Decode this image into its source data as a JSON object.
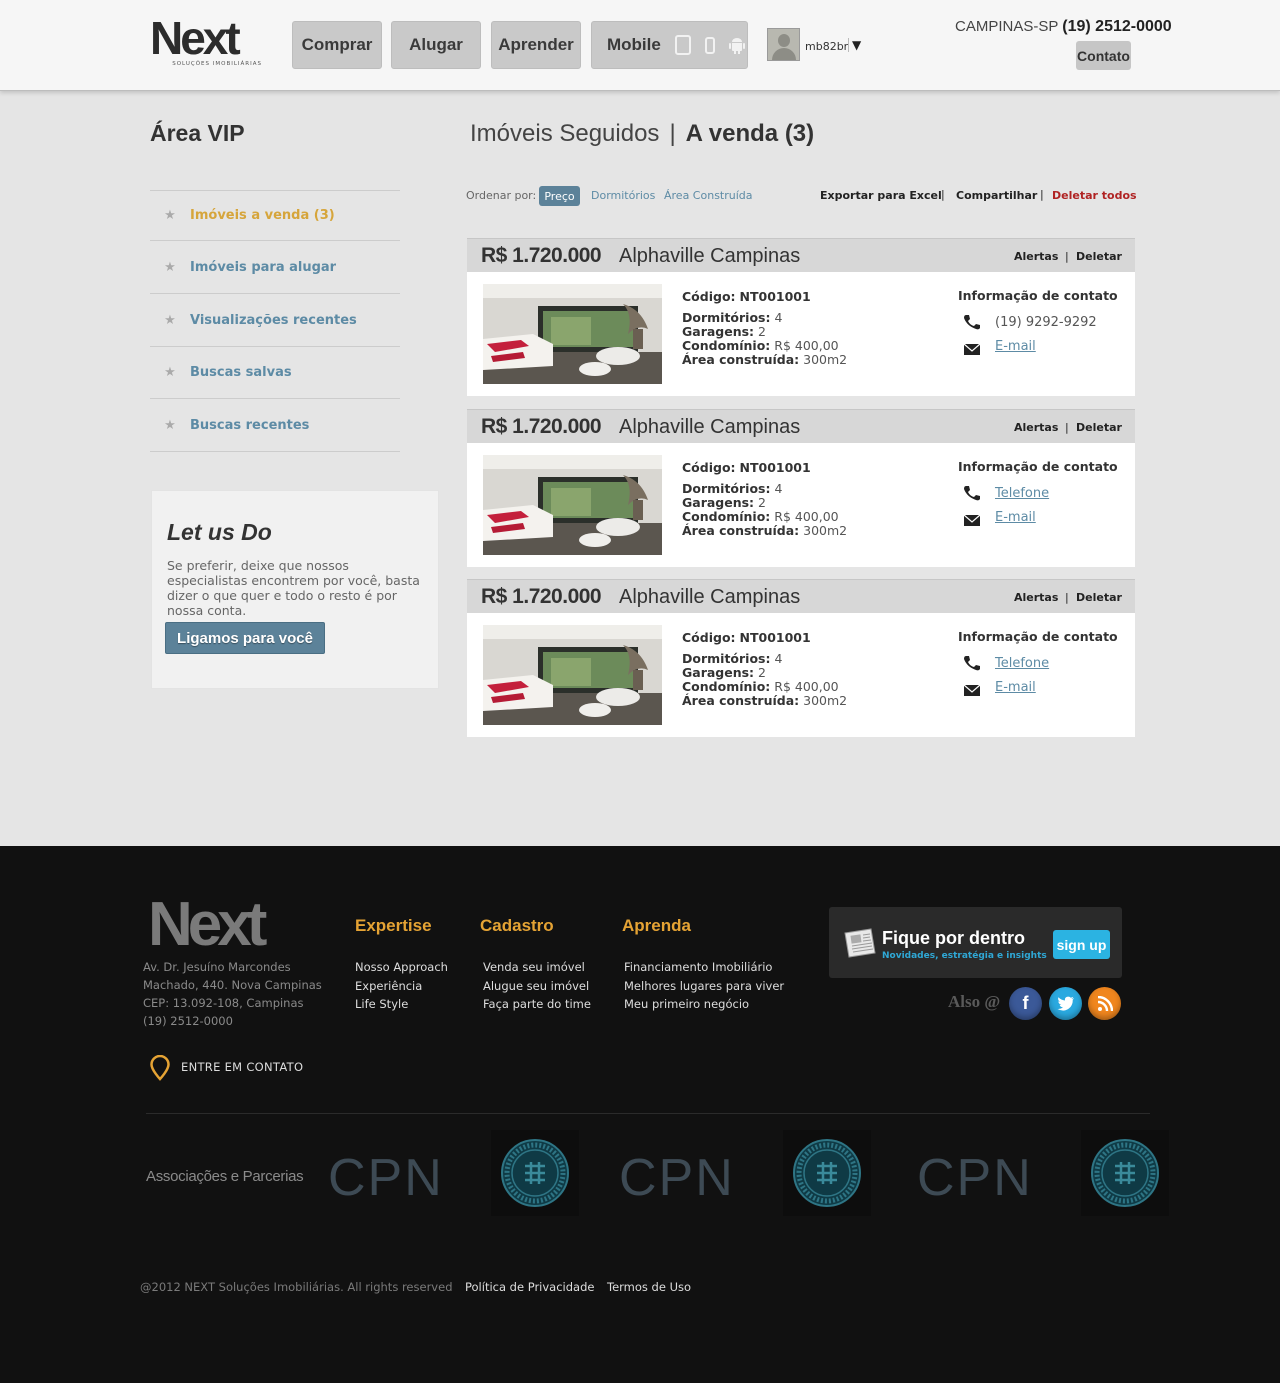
{
  "header": {
    "logo_text": "Next",
    "logo_subtitle": "SOLUÇÕES IMOBILIÁRIAS",
    "nav": {
      "comprar": "Comprar",
      "alugar": "Alugar",
      "aprender": "Aprender",
      "mobile": "Mobile"
    },
    "mobile_icons": [
      "tablet-icon",
      "phone-icon",
      "android-icon"
    ],
    "username": "mb82br",
    "user_arrow": "▼",
    "location": "CAMPINAS-SP",
    "phone": "(19) 2512-0000",
    "contato": "Contato"
  },
  "sidebar": {
    "title": "Área VIP",
    "items": [
      {
        "label": "Imóveis a venda (3)",
        "active": true
      },
      {
        "label": "Imóveis para alugar",
        "active": false
      },
      {
        "label": "Visualizações recentes",
        "active": false
      },
      {
        "label": "Buscas salvas",
        "active": false
      },
      {
        "label": "Buscas recentes",
        "active": false
      }
    ],
    "star_glyph": "★",
    "letus": {
      "title": "Let us Do",
      "text": "Se preferir, deixe que nossos especialistas encontrem por você, basta dizer o que quer e todo o resto é por nossa conta.",
      "button": "Ligamos para você"
    }
  },
  "main": {
    "title_left": "Imóveis Seguidos",
    "title_sep": "|",
    "title_right": "A venda (3)",
    "toolbar": {
      "order_label": "Ordenar por:",
      "sort_options": [
        "Preço",
        "Dormitórios",
        "Área Construída"
      ],
      "sort_selected": "Preço",
      "export": "Exportar para Excel",
      "share": "Compartilhar",
      "delete_all": "Deletar todos",
      "sep": "|"
    },
    "listing_labels": {
      "alertas": "Alertas",
      "deletar": "Deletar",
      "sep": "|",
      "codigo": "Código:",
      "dormitorios": "Dormitórios:",
      "garagens": "Garagens:",
      "condominio": "Condomínio:",
      "area": "Área construída:",
      "info_title": "Informação de contato",
      "email": "E-mail"
    },
    "listings": [
      {
        "price": "R$ 1.720.000",
        "location": "Alphaville Campinas",
        "code": "NT001001",
        "dormitorios": "4",
        "garagens": "2",
        "condominio": "R$ 400,00",
        "area": "300m2",
        "phone": "(19) 9292-9292"
      },
      {
        "price": "R$ 1.720.000",
        "location": "Alphaville Campinas",
        "code": "NT001001",
        "dormitorios": "4",
        "garagens": "2",
        "condominio": "R$ 400,00",
        "area": "300m2",
        "phone": "Telefone"
      },
      {
        "price": "R$ 1.720.000",
        "location": "Alphaville Campinas",
        "code": "NT001001",
        "dormitorios": "4",
        "garagens": "2",
        "condominio": "R$ 400,00",
        "area": "300m2",
        "phone": "Telefone"
      }
    ]
  },
  "footer": {
    "logo_text": "Next",
    "address": [
      "Av. Dr. Jesuíno Marcondes",
      "Machado, 440. Nova Campinas",
      "CEP: 13.092-108, Campinas",
      "(19) 2512-0000"
    ],
    "contact": "ENTRE EM CONTATO",
    "columns": [
      {
        "title": "Expertise",
        "links": [
          "Nosso Approach",
          "Experiência",
          "Life Style"
        ]
      },
      {
        "title": "Cadastro",
        "links": [
          "Venda seu imóvel",
          "Alugue seu imóvel",
          "Faça parte do time"
        ]
      },
      {
        "title": "Aprenda",
        "links": [
          "Financiamento Imobiliário",
          "Melhores lugares para viver",
          "Meu primeiro negócio"
        ]
      }
    ],
    "newsletter": {
      "title": "Fique por dentro",
      "subtitle": "Novidades, estratégia e insights",
      "button": "sign up"
    },
    "also": "Also @",
    "social": [
      "facebook-icon",
      "twitter-icon",
      "rss-icon"
    ],
    "assoc_label": "Associações e Parcerias",
    "partners": [
      "CPN",
      "Guarani Futebol Clube",
      "CPN",
      "Guarani Futebol Clube",
      "CPN",
      "Guarani Futebol Clube"
    ],
    "cpn_text": "CPN",
    "copyright": "@2012 NEXT Soluções Imobiliárias. All rights reserved",
    "privacy": "Política de Privacidade",
    "terms": "Termos de Uso"
  },
  "colors": {
    "accent_blue": "#5c8299",
    "link_blue": "#5d8ba5",
    "accent_gold": "#e5a334",
    "delete_red": "#b02323"
  }
}
